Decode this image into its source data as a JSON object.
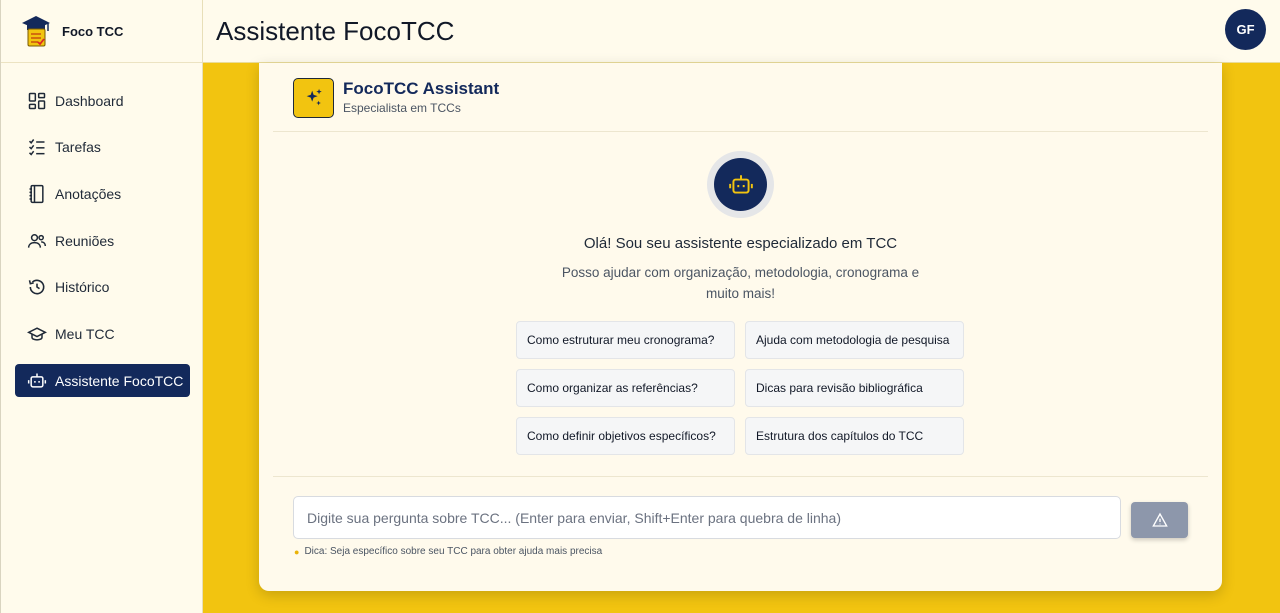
{
  "brand": {
    "name": "Foco TCC"
  },
  "nav": {
    "items": [
      {
        "label": "Dashboard",
        "icon": "dashboard-icon"
      },
      {
        "label": "Tarefas",
        "icon": "tasks-icon"
      },
      {
        "label": "Anotações",
        "icon": "notebook-icon"
      },
      {
        "label": "Reuniões",
        "icon": "users-icon"
      },
      {
        "label": "Histórico",
        "icon": "history-icon"
      },
      {
        "label": "Meu TCC",
        "icon": "graduation-cap-icon"
      },
      {
        "label": "Assistente FocoTCC",
        "icon": "robot-icon",
        "active": true
      }
    ]
  },
  "header": {
    "title": "Assistente FocoTCC",
    "avatar_initials": "GF"
  },
  "assistant": {
    "title": "FocoTCC Assistant",
    "subtitle": "Especialista em TCCs"
  },
  "welcome": {
    "title": "Olá! Sou seu assistente especializado em TCC",
    "subtitle": "Posso ajudar com organização, metodologia, cronograma e muito mais!"
  },
  "suggestions": [
    "Como estruturar meu cronograma?",
    "Ajuda com metodologia de pesquisa",
    "Como organizar as referências?",
    "Dicas para revisão bibliográfica",
    "Como definir objetivos específicos?",
    "Estrutura dos capítulos do TCC"
  ],
  "chat": {
    "placeholder": "Digite sua pergunta sobre TCC... (Enter para enviar, Shift+Enter para quebra de linha)",
    "tip": "Dica: Seja específico sobre seu TCC para obter ajuda mais precisa"
  },
  "colors": {
    "navy": "#13295b",
    "yellow": "#f2c410",
    "cream": "#fffbec",
    "send_button": "#8d97ab"
  }
}
